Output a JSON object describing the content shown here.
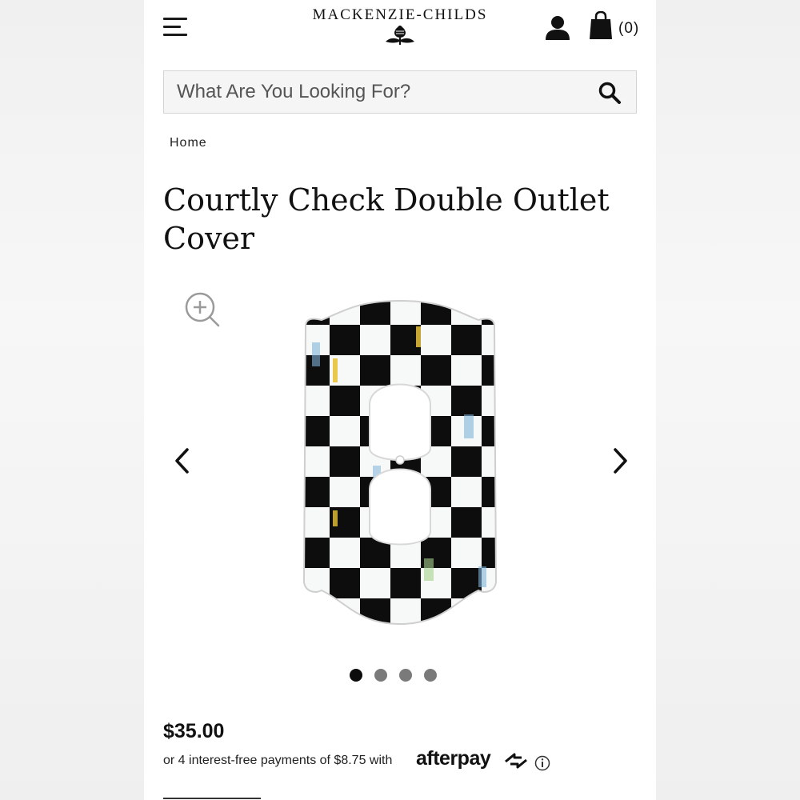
{
  "header": {
    "brand_name": "MACKENZIE-CHILDS",
    "cart_count": "(0)"
  },
  "search": {
    "placeholder": "What Are You Looking For?"
  },
  "breadcrumb": {
    "home": "Home"
  },
  "product": {
    "title": "Courtly Check Double Outlet Cover",
    "price": "$35.00",
    "installments_text": "or 4 interest-free payments of $8.75 with",
    "afterpay_label": "afterpay"
  },
  "carousel": {
    "image_count": 4,
    "active_index": 0
  },
  "colors": {
    "text": "#111111",
    "search_bg": "#f5f5f6",
    "dot_active": "#0c0c0c",
    "dot_inactive": "#7a7a7a"
  },
  "icons": [
    "menu-icon",
    "thistle-logo-icon",
    "account-icon",
    "shopping-bag-icon",
    "search-icon",
    "zoom-in-icon",
    "chevron-left-icon",
    "chevron-right-icon",
    "afterpay-arrows-icon",
    "info-icon"
  ]
}
